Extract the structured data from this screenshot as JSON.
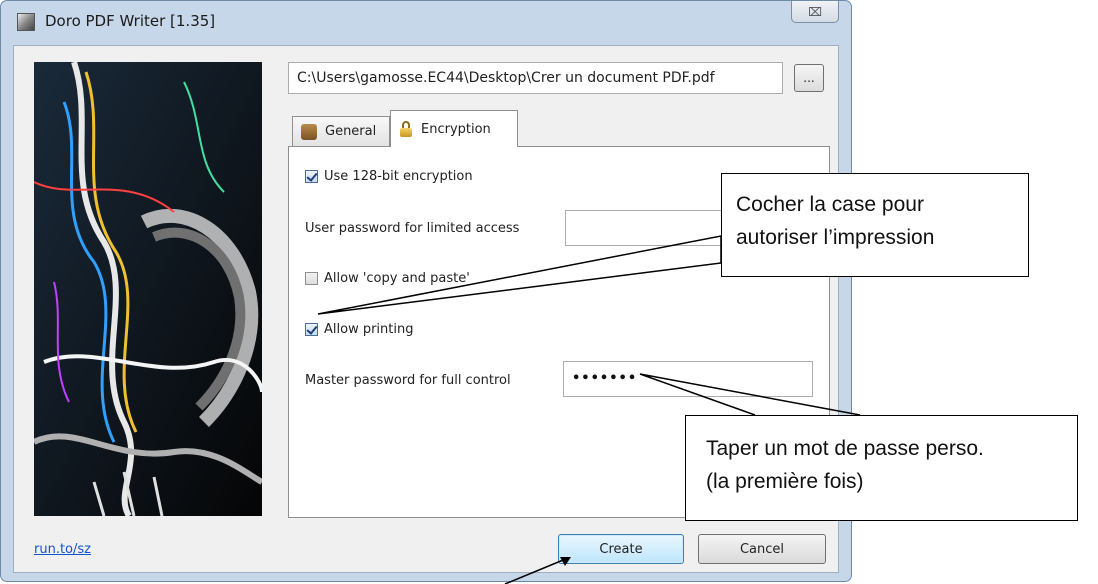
{
  "window": {
    "title": "Doro PDF Writer [1.35]",
    "close_symbol": "⌧"
  },
  "file": {
    "path": "C:\\Users\\gamosse.EC44\\Desktop\\Crer un document PDF.pdf",
    "browse_label": "..."
  },
  "tabs": [
    {
      "label": "General",
      "icon": "general-icon",
      "selected": false
    },
    {
      "label": "Encryption",
      "icon": "lock-icon",
      "selected": true
    }
  ],
  "encryption": {
    "use_128_label": "Use 128-bit encryption",
    "use_128_checked": true,
    "user_password_label": "User password for limited access",
    "user_password_value": "",
    "allow_copy_label": "Allow 'copy and paste'",
    "allow_copy_checked": false,
    "allow_printing_label": "Allow printing",
    "allow_printing_checked": true,
    "master_password_label": "Master password for full control",
    "master_password_value": "•••••••"
  },
  "footer": {
    "link": "run.to/sz",
    "create_label": "Create",
    "cancel_label": "Cancel"
  },
  "callouts": {
    "print_line1": "Cocher la case pour",
    "print_line2": "autoriser l’impression",
    "password_line1": "Taper un mot de passe perso.",
    "password_line2": "(la première fois)"
  }
}
